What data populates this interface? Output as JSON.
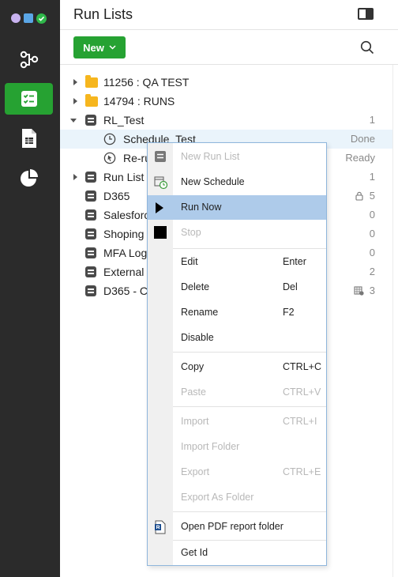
{
  "header": {
    "title": "Run Lists"
  },
  "toolbar": {
    "new_label": "New"
  },
  "tree": [
    {
      "label": "11256 : QA TEST",
      "icon": "folder-icon",
      "status": ""
    },
    {
      "label": "14794 : RUNS",
      "icon": "folder-icon",
      "status": ""
    },
    {
      "label": "RL_Test",
      "icon": "run-list-icon",
      "status": "1"
    },
    {
      "label": "Schedule_Test",
      "icon": "clock-icon",
      "status": "Done"
    },
    {
      "label": "Re-ru",
      "icon": "trigger-icon",
      "status": "Ready"
    },
    {
      "label": "Run List 1",
      "icon": "run-list-icon",
      "status": "1"
    },
    {
      "label": "D365",
      "icon": "run-list-icon",
      "status": "5"
    },
    {
      "label": "Salesforc",
      "icon": "run-list-icon",
      "status": "0"
    },
    {
      "label": "Shoping",
      "icon": "run-list-icon",
      "status": "0"
    },
    {
      "label": "MFA Log",
      "icon": "run-list-icon",
      "status": "0"
    },
    {
      "label": "External",
      "icon": "run-list-icon",
      "status": "2"
    },
    {
      "label": "D365 - C",
      "icon": "run-list-icon",
      "status": "3"
    }
  ],
  "context_menu": {
    "items": [
      {
        "label": "New Run List",
        "key": "",
        "enabled": false
      },
      {
        "label": "New Schedule",
        "key": "",
        "enabled": true
      },
      {
        "label": "Run Now",
        "key": "",
        "enabled": true,
        "highlighted": true
      },
      {
        "label": "Stop",
        "key": "",
        "enabled": false
      },
      {
        "label": "Edit",
        "key": "Enter",
        "enabled": true
      },
      {
        "label": "Delete",
        "key": "Del",
        "enabled": true
      },
      {
        "label": "Rename",
        "key": "F2",
        "enabled": true
      },
      {
        "label": "Disable",
        "key": "",
        "enabled": true
      },
      {
        "label": "Copy",
        "key": "CTRL+C",
        "enabled": true
      },
      {
        "label": "Paste",
        "key": "CTRL+V",
        "enabled": false
      },
      {
        "label": "Import",
        "key": "CTRL+I",
        "enabled": false
      },
      {
        "label": "Import Folder",
        "key": "",
        "enabled": false
      },
      {
        "label": "Export",
        "key": "CTRL+E",
        "enabled": false
      },
      {
        "label": "Export As Folder",
        "key": "",
        "enabled": false
      },
      {
        "label": "Open PDF report folder",
        "key": "",
        "enabled": true
      },
      {
        "label": "Get Id",
        "key": "",
        "enabled": true
      }
    ]
  },
  "colors": {
    "accent_green": "#26a232",
    "sidebar_bg": "#2b2b2b",
    "menu_highlight": "#aecbea",
    "selected_row": "#eaf4fb"
  }
}
